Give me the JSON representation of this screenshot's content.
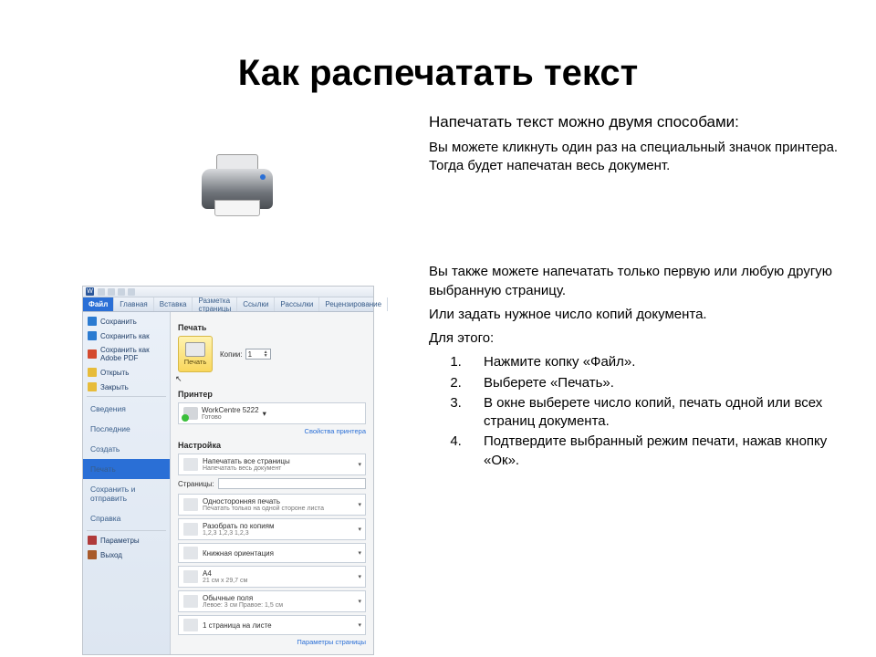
{
  "title": "Как распечатать текст",
  "right": {
    "lead": "Напечатать текст можно двумя способами:",
    "para1a": "Вы можете кликнуть один раз на специальный значок принтера. Тогда будет напечатан весь документ.",
    "para2a": "Вы также можете напечатать только первую или любую другую выбранную страницу.",
    "para2b": "Или задать нужное число копий документа.",
    "para2c": "Для этого:",
    "steps": [
      "Нажмите копку «Файл».",
      "Выберете «Печать».",
      "В окне выберете число копий, печать одной или всех страниц документа.",
      "Подтвердите выбранный режим печати, нажав кнопку «Ок»."
    ]
  },
  "word": {
    "tabs": [
      "Файл",
      "Главная",
      "Вставка",
      "Разметка страницы",
      "Ссылки",
      "Рассылки",
      "Рецензирование"
    ],
    "sidebar_top": [
      {
        "label": "Сохранить",
        "icon": "#2b7bd1"
      },
      {
        "label": "Сохранить как",
        "icon": "#2b7bd1"
      },
      {
        "label": "Сохранить как Adobe PDF",
        "icon": "#d44a2f"
      },
      {
        "label": "Открыть",
        "icon": "#e7bc3a"
      },
      {
        "label": "Закрыть",
        "icon": "#e7bc3a"
      }
    ],
    "sidebar_mid": [
      "Сведения",
      "Последние",
      "Создать",
      "Печать",
      "Сохранить и отправить",
      "Справка"
    ],
    "sidebar_bot": [
      {
        "label": "Параметры",
        "icon": "#b03a3a"
      },
      {
        "label": "Выход",
        "icon": "#a85a2a"
      }
    ],
    "print": {
      "heading": "Печать",
      "button_label": "Печать",
      "copies_label": "Копии:",
      "copies_value": "1",
      "printer_heading": "Принтер",
      "printer_name": "WorkCentre 5222",
      "printer_status": "Готово",
      "printer_props": "Свойства принтера",
      "settings_heading": "Настройка",
      "opt_all_t": "Напечатать все страницы",
      "opt_all_s": "Напечатать весь документ",
      "pages_label": "Страницы:",
      "opt_side_t": "Односторонняя печать",
      "opt_side_s": "Печатать только на одной стороне листа",
      "opt_collate_t": "Разобрать по копиям",
      "opt_collate_s": "1,2,3   1,2,3   1,2,3",
      "opt_orient_t": "Книжная ориентация",
      "opt_size_t": "A4",
      "opt_size_s": "21 см x 29,7 см",
      "opt_margins_t": "Обычные поля",
      "opt_margins_s": "Левое: 3 см   Правое: 1,5 см",
      "opt_pps_t": "1 страница на листе",
      "page_setup": "Параметры страницы"
    }
  }
}
